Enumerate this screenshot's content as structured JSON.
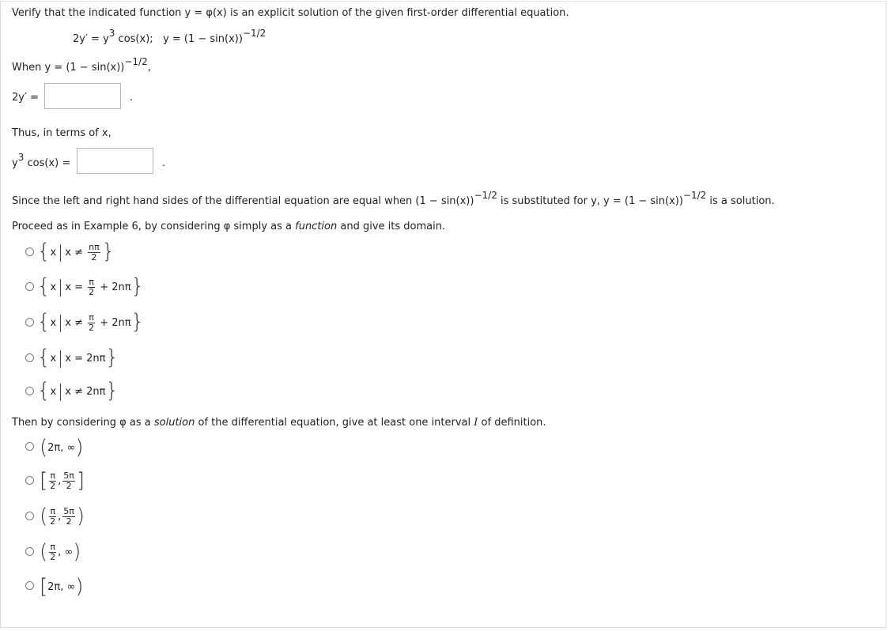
{
  "intro": "Verify that the indicated function y = φ(x) is an explicit solution of the given first-order differential equation.",
  "equation": {
    "ode_lhs": "2y′ = y",
    "ode_exp": "3",
    "ode_rhs": " cos(x);",
    "solution": "y = (1 − sin(x))",
    "solution_exp": "−1/2"
  },
  "step1": {
    "when_prefix": "When y = (1 − sin(x))",
    "when_exp": "−1/2",
    "when_suffix": ",",
    "deriv_label": "2y′ ="
  },
  "step2": {
    "thus": "Thus, in terms of x,",
    "label_y": "y",
    "label_exp": "3",
    "label_rest": " cos(x) ="
  },
  "since": {
    "part1": "Since the left and right hand sides of the differential equation are equal when (1 − sin(x))",
    "exp1": "−1/2",
    "part2": " is substituted for y, y = (1 − sin(x))",
    "exp2": "−1/2",
    "part3": " is a solution."
  },
  "domain_question": {
    "prefix": "Proceed as in Example 6, by considering φ simply as a ",
    "emph": "function",
    "suffix": " and give its domain."
  },
  "domain_options": [
    {
      "var": "x",
      "rel": "x ≠",
      "num": "nπ",
      "den": "2",
      "tail": ""
    },
    {
      "var": "x",
      "rel": "x =",
      "num": "π",
      "den": "2",
      "tail": "+ 2nπ"
    },
    {
      "var": "x",
      "rel": "x ≠",
      "num": "π",
      "den": "2",
      "tail": "+ 2nπ"
    },
    {
      "var": "x",
      "rel": "x = 2nπ",
      "num": "",
      "den": "",
      "tail": ""
    },
    {
      "var": "x",
      "rel": "x ≠ 2nπ",
      "num": "",
      "den": "",
      "tail": ""
    }
  ],
  "interval_question": {
    "prefix": "Then by considering φ as a ",
    "emph": "solution",
    "middle": " of the differential equation, give at least one interval ",
    "var": "I",
    "suffix": " of definition."
  },
  "interval_options": [
    {
      "open": "(",
      "close": ")",
      "a": "2π",
      "b": "∞"
    },
    {
      "open": "[",
      "close": "]",
      "a_num": "π",
      "a_den": "2",
      "b_num": "5π",
      "b_den": "2"
    },
    {
      "open": "(",
      "close": ")",
      "a_num": "π",
      "a_den": "2",
      "b_num": "5π",
      "b_den": "2"
    },
    {
      "open": "(",
      "close": ")",
      "a_num": "π",
      "a_den": "2",
      "b": "∞"
    },
    {
      "open": "[",
      "close": ")",
      "a": "2π",
      "b": "∞"
    }
  ],
  "answers": {
    "deriv": "",
    "rhs": ""
  }
}
